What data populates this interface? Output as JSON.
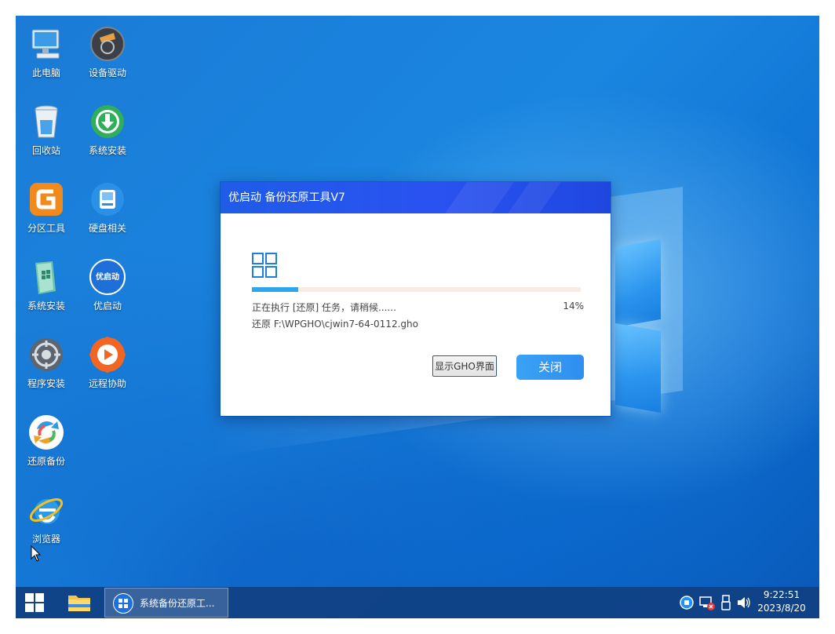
{
  "desktop": {
    "icons": [
      {
        "label": "此电脑",
        "icon": "computer-icon"
      },
      {
        "label": "设备驱动",
        "icon": "device-driver-icon"
      },
      {
        "label": "回收站",
        "icon": "recycle-bin-icon"
      },
      {
        "label": "系统安装",
        "icon": "download-install-icon"
      },
      {
        "label": "分区工具",
        "icon": "partition-tool-icon"
      },
      {
        "label": "硬盘相关",
        "icon": "hard-disk-icon"
      },
      {
        "label": "系统安装",
        "icon": "system-install-icon"
      },
      {
        "label": "优启动",
        "icon": "youqidong-icon"
      },
      {
        "label": "程序安装",
        "icon": "program-install-icon"
      },
      {
        "label": "远程协助",
        "icon": "remote-assist-icon"
      },
      {
        "label": "还原备份",
        "icon": "restore-backup-icon"
      },
      {
        "label": "浏览器",
        "icon": "internet-explorer-icon"
      }
    ],
    "logo_text": "优启动"
  },
  "dialog": {
    "title": "优启动  备份还原工具V7",
    "progress_percent": 14,
    "progress_label": "14%",
    "status_text": "正在执行 [还原] 任务，请稍候......",
    "path_text": "还原   F:\\WPGHO\\cjwin7-64-0112.gho",
    "show_ghost_button": "显示GHO界面",
    "close_button": "关闭",
    "colors": {
      "title_bar": "#2a52f0",
      "progress": "#2ea6ea",
      "close_button": "#3aa2f4"
    }
  },
  "taskbar": {
    "task_label": "系统备份还原工...",
    "clock_time": "9:22:51",
    "clock_date": "2023/8/20",
    "color": "#104082"
  }
}
